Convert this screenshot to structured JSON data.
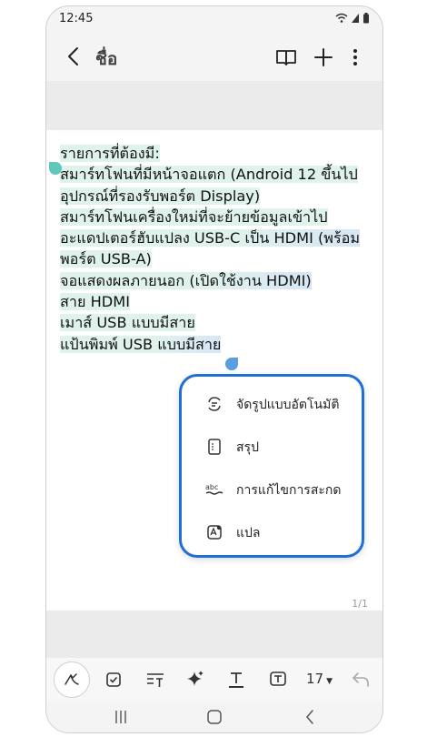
{
  "status": {
    "time": "12:45"
  },
  "header": {
    "title": "ชื่อ"
  },
  "note": {
    "lines": [
      "รายการที่ต้องมี:",
      "สมาร์ทโฟนที่มีหน้าจอแตก (Android 12 ขึ้นไป",
      "อุปกรณ์ที่รองรับพอร์ต Display)",
      "สมาร์ทโฟนเครื่องใหม่ที่จะย้ายข้อมูลเข้าไป",
      "อะแดปเตอร์ฮับแปลง USB-C เป็น HDMI (พร้อม",
      "พอร์ต USB-A)",
      "จอแสดงผลภายนอก (เปิดใช้งาน HDMI)",
      "สาย HDMI",
      "เมาส์ USB แบบมีสาย",
      "แป้นพิมพ์ USB แบบมีสาย"
    ],
    "page_indicator": "1/1"
  },
  "menu": {
    "items": [
      {
        "label": "จัดรูปแบบอัตโนมัติ",
        "icon": "auto-format-icon"
      },
      {
        "label": "สรุป",
        "icon": "summarize-icon"
      },
      {
        "label": "การแก้ไขการสะกด",
        "icon": "spell-check-icon"
      },
      {
        "label": "แปล",
        "icon": "translate-icon"
      }
    ]
  },
  "toolbar": {
    "font_size": "17"
  },
  "colors": {
    "accent": "#1f6fd6",
    "selection": "#dff2ec",
    "handle_start": "#5fc7bb",
    "handle_end": "#5a9ee2"
  }
}
